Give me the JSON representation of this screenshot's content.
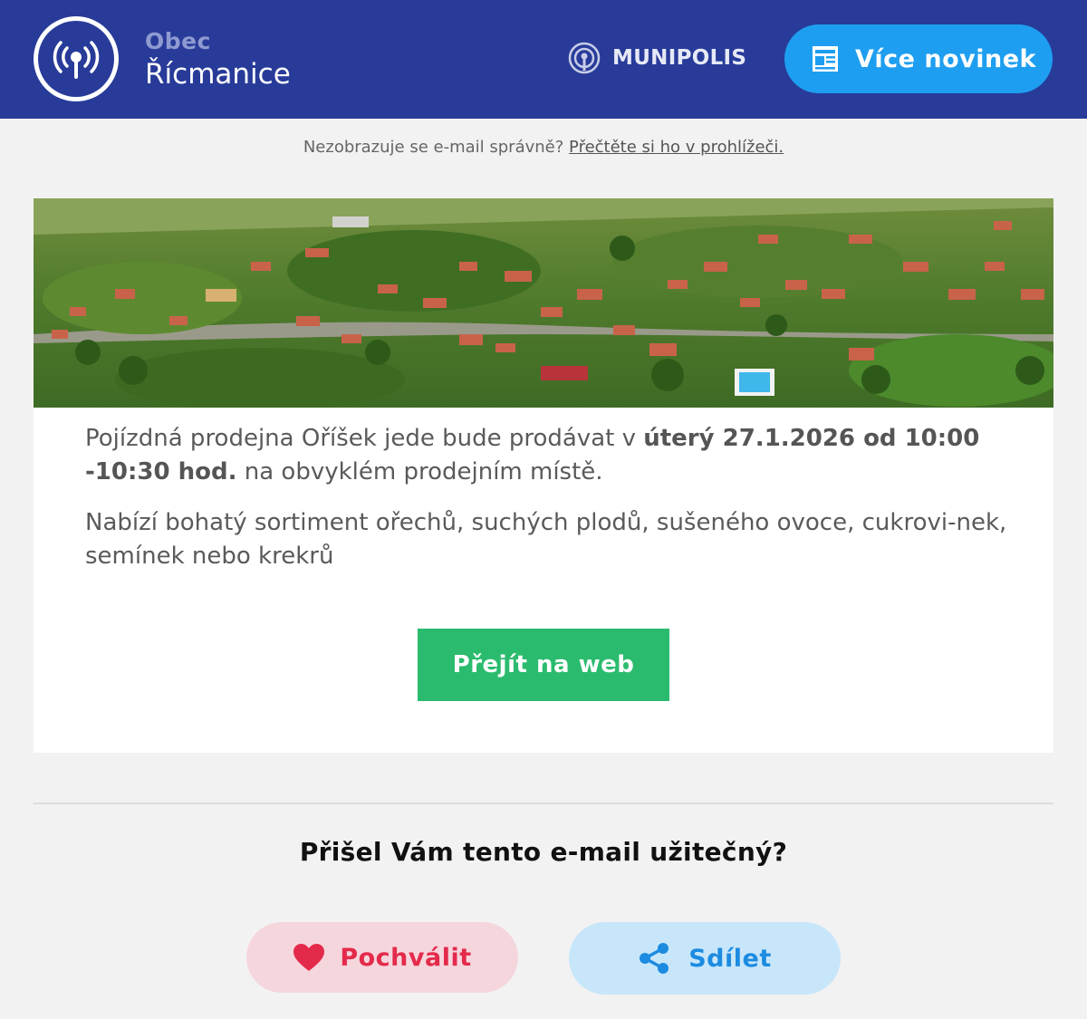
{
  "header": {
    "brand_small": "Obec",
    "brand_big": "Řícmanice",
    "partner": "MUNIPOLIS",
    "more_news_label": "Více novinek"
  },
  "notice": {
    "text": "Nezobrazuje se e-mail správně?",
    "link": "Přečtěte si ho v prohlížeči."
  },
  "article": {
    "p1_start": "Pojízdná prodejna Oříšek jede bude prodávat v ",
    "p1_bold": "úterý 27.1.2026 od 10:00 -10:30 hod.",
    "p1_end": " na obvyklém prodejním místě.",
    "p2": "Nabízí bohatý sortiment ořechů, suchých plodů, sušeného ovoce, cukrovi-nek, semínek nebo krekrů",
    "cta_label": "Přejít na web"
  },
  "feedback": {
    "question": "Přišel Vám tento e-mail užitečný?",
    "praise_label": "Pochválit",
    "share_label": "Sdílet"
  },
  "colors": {
    "header_bg": "#283b99",
    "more_btn": "#1e9ef0",
    "cta": "#2bbb6e",
    "praise": "#e42a4b",
    "share": "#1c8be0"
  }
}
